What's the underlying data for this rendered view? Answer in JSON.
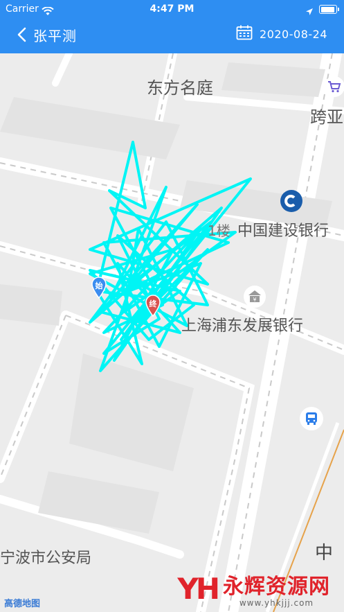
{
  "status_bar": {
    "carrier": "Carrier",
    "time": "4:47 PM"
  },
  "nav": {
    "title": "张平测",
    "date": "2020-08-24"
  },
  "map": {
    "pois": {
      "dongfang": "东方名庭",
      "kuaya": "跨亚",
      "ccb": "中国建设银行",
      "spdb": "上海浦东发展银行",
      "police": "宁波市公安局",
      "partial": "1楼"
    },
    "markers": {
      "start": "始",
      "end": "终"
    },
    "track_color": "#00f5f5",
    "logo": "高德地图",
    "road_label": "中"
  },
  "watermark": {
    "logo": "YH",
    "name": "永辉资源网",
    "url": "www.yhkjjj.com"
  },
  "colors": {
    "header": "#2e8ef2",
    "start_marker": "#3b8df0",
    "end_marker": "#d9534f"
  }
}
